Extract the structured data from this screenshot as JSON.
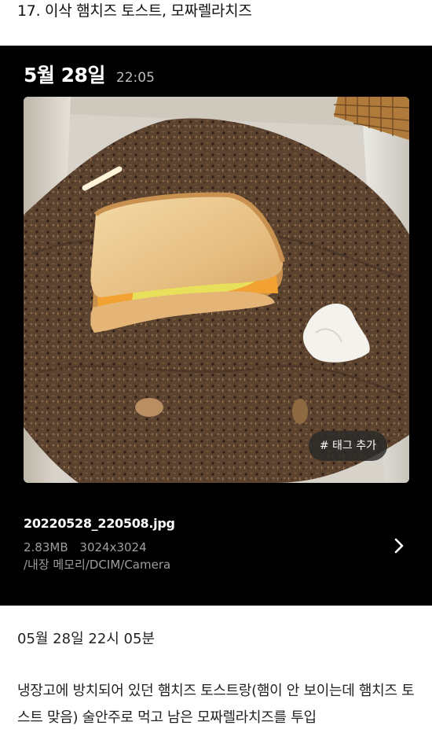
{
  "post": {
    "title": "17. 이삭 햄치즈 토스트, 모짜렐라치즈"
  },
  "viewer": {
    "date": "5월 28일",
    "time": "22:05",
    "photo": {
      "subject": "toast-in-substrate-bin",
      "tag_button": "# 태그 추가"
    },
    "file": {
      "name": "20220528_220508.jpg",
      "size": "2.83MB",
      "resolution": "3024x3024",
      "path": "/내장 메모리/DCIM/Camera"
    },
    "details_icon": "chevron-right-icon"
  },
  "entry": {
    "timestamp": "05월 28일 22시 05분",
    "caption": "냉장고에 방치되어 있던 햄치즈 토스트랑(햄이 안 보이는데 햄치즈 토스트 맞음) 술안주로 먹고 남은 모짜렐라치즈를 투입"
  },
  "colors": {
    "viewer_bg": "#000000",
    "page_bg": "#ffffff",
    "tag_bg": "#282828"
  }
}
